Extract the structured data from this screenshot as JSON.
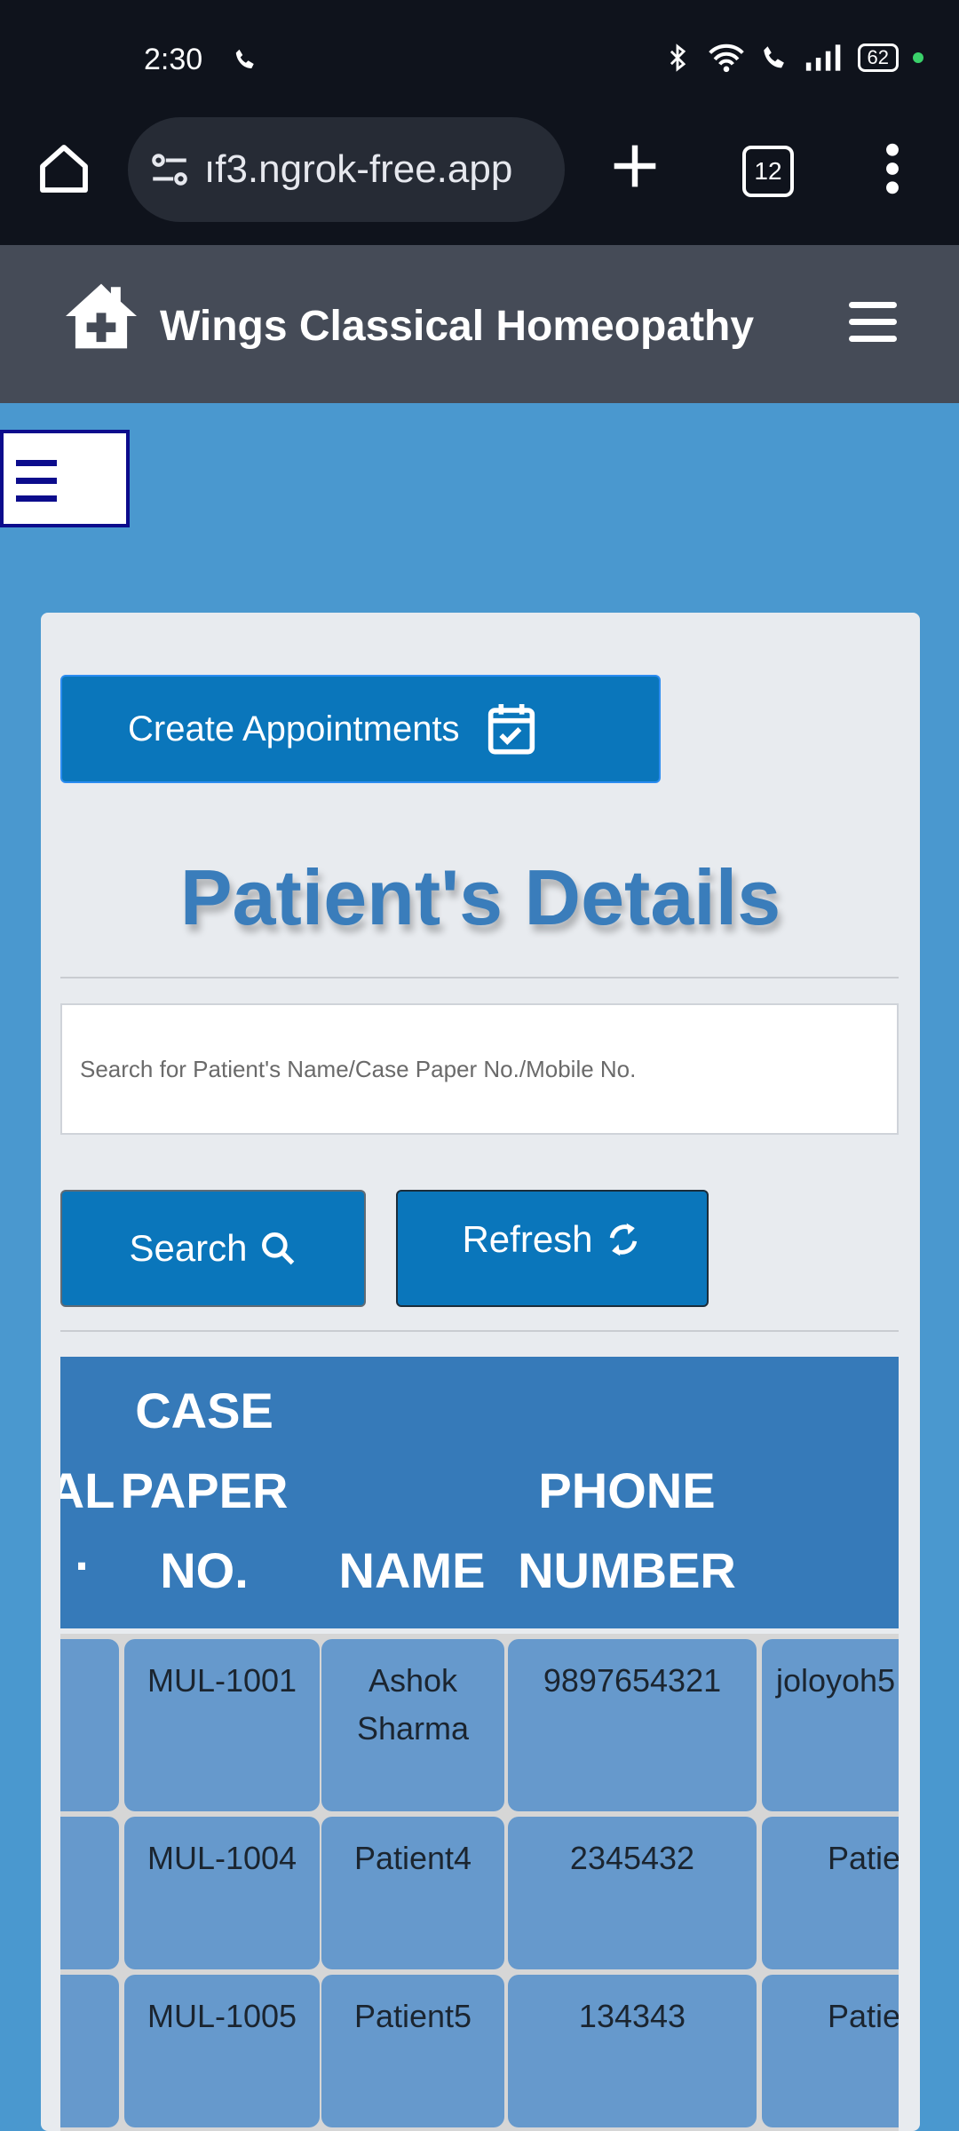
{
  "status_bar": {
    "time": "2:30",
    "battery": "62"
  },
  "browser": {
    "url": "ıf3.ngrok-free.app",
    "tab_count": "12"
  },
  "app": {
    "title": "Wings Classical Homeopathy"
  },
  "card": {
    "create_button": "Create Appointments",
    "page_title": "Patient's Details",
    "search_placeholder": "Search for Patient's Name/Case Paper No./Mobile No.",
    "search_button": "Search",
    "refresh_button": "Refresh"
  },
  "table": {
    "headers": {
      "col0_l1": "AL",
      "col0_l2": ".",
      "case_l1": "CASE",
      "case_l2": "PAPER",
      "case_l3": "NO.",
      "name": "NAME",
      "phone_l1": "PHONE",
      "phone_l2": "NUMBER"
    },
    "rows": [
      {
        "case": "MUL-1001",
        "name_l1": "Ashok",
        "name_l2": "Sharma",
        "phone": "9897654321",
        "extra": "joloyoh5"
      },
      {
        "case": "MUL-1004",
        "name_l1": "Patient4",
        "name_l2": "",
        "phone": "2345432",
        "extra": "Patie"
      },
      {
        "case": "MUL-1005",
        "name_l1": "Patient5",
        "name_l2": "",
        "phone": "134343",
        "extra": "Patie"
      }
    ]
  },
  "colors": {
    "page_bg": "#4a98cf",
    "header_bg": "#454b57",
    "primary_button": "#0a76bb",
    "title_blue": "#3a7dbb",
    "table_header": "#367ab9",
    "table_cell": "#6699cc"
  }
}
